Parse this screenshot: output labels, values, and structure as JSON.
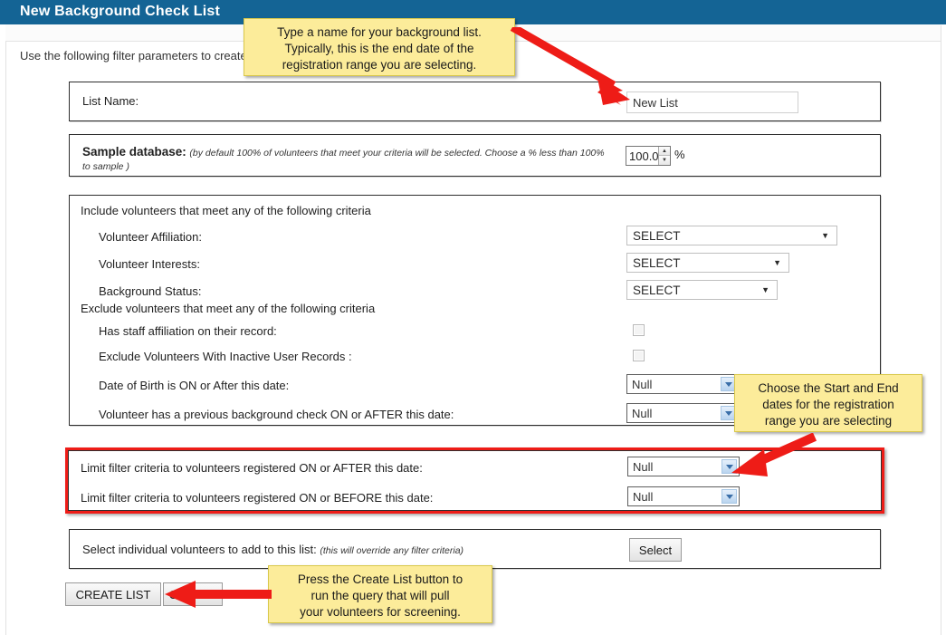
{
  "header": {
    "title": "New Background Check List"
  },
  "intro": {
    "text": "Use the following filter parameters to create your list"
  },
  "list_name_panel": {
    "label": "List Name:",
    "input_value": "New List",
    "input_placeholder": ""
  },
  "sample_panel": {
    "label": "Sample database:",
    "note": "(by default 100% of volunteers that meet your criteria will be selected. Choose a % less than 100% to sample )",
    "value": "100.0",
    "percent_sign": "%",
    "spinner_up": "▲",
    "spinner_down": "▼"
  },
  "criteria_panel": {
    "include_heading": "Include volunteers that meet any of the following criteria",
    "exclude_heading": "Exclude volunteers that meet any of the following criteria",
    "include_rows": [
      {
        "label": "Volunteer Affiliation:",
        "value": "SELECT"
      },
      {
        "label": "Volunteer Interests:",
        "value": "SELECT"
      },
      {
        "label": "Background Status:",
        "value": "SELECT"
      }
    ],
    "exclude_rows": [
      {
        "label": "Has staff affiliation on their record:",
        "control": "checkbox",
        "checked": false
      },
      {
        "label": "Exclude Volunteers With Inactive User Records :",
        "control": "checkbox",
        "checked": false
      },
      {
        "label": "Date of Birth is ON or After this date:",
        "control": "select",
        "value": "Null"
      },
      {
        "label": "Volunteer has a previous background check ON or AFTER this date:",
        "control": "select",
        "value": "Null"
      }
    ]
  },
  "registration_panel": {
    "rows": [
      {
        "label": "Limit filter criteria to volunteers registered ON or AFTER this date:",
        "value": "Null"
      },
      {
        "label": "Limit filter criteria to volunteers registered ON or BEFORE this date:",
        "value": "Null"
      }
    ]
  },
  "individual_panel": {
    "label": "Select individual volunteers to add to this list:",
    "note": "(this will override any filter criteria)",
    "button": "Select"
  },
  "actions": {
    "create_list": "CREATE LIST",
    "cancel": "CANCEL"
  },
  "callouts": [
    {
      "id": "callout-list-name",
      "line1": "Type a name for your background list.",
      "line2": "Typically, this is the end date of the",
      "line3": "registration range you are selecting."
    },
    {
      "id": "callout-dates",
      "line1": "Choose the Start and End",
      "line2": "dates for the registration",
      "line3": "range you are selecting"
    },
    {
      "id": "callout-create",
      "line1": "Press the Create List button to",
      "line2": "run the query that will pull",
      "line3": "your volunteers for screening."
    }
  ],
  "colors": {
    "header_bar": "#146495",
    "callout_bg": "#fcec9a",
    "callout_border": "#d9c84a",
    "arrow_red": "#ee1c17",
    "highlight_box": "#ee1c17"
  }
}
